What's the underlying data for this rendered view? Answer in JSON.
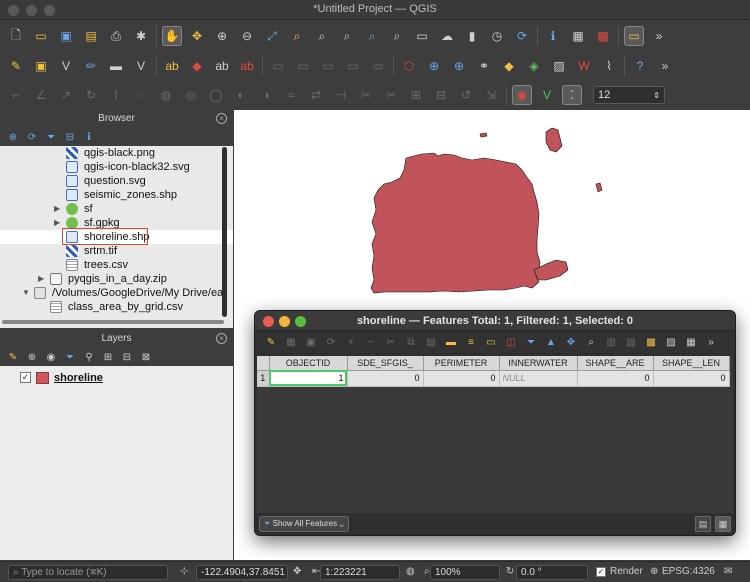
{
  "window": {
    "title": "*Untitled Project — QGIS"
  },
  "toolbar": {
    "row1_icons": [
      "new-project",
      "open",
      "save",
      "save-as",
      "print-layout",
      "style-manager",
      "pan",
      "pan-to-selection",
      "zoom-in",
      "zoom-out",
      "zoom-full",
      "zoom-to-selection",
      "zoom-to-layer",
      "zoom-native",
      "zoom-last",
      "zoom-next",
      "new-map-view",
      "new-3d-view",
      "refresh",
      "identify",
      "open-attribute-table",
      "field-calculator",
      "select-features",
      "deselect",
      "measure",
      "time-controller",
      "map-tips"
    ],
    "row2_icons": [
      "digitize",
      "layer-style",
      "label-toolbar",
      "edit-pencil",
      "save-edits",
      "add-feature",
      "label-abc",
      "pin-labels",
      "show-hide-labels",
      "label-highlight",
      "move-label",
      "rotate-label",
      "change-label",
      "diagram",
      "polygon-tool",
      "processing-toolbox",
      "plugin",
      "python-console",
      "qgis-help"
    ],
    "font_size": "12"
  },
  "browser": {
    "title": "Browser",
    "items": [
      {
        "label": "qgis-black.png",
        "icon": "raster-icon",
        "level": 3
      },
      {
        "label": "qgis-icon-black32.svg",
        "icon": "svg-icon",
        "level": 3
      },
      {
        "label": "question.svg",
        "icon": "svg-icon",
        "level": 3
      },
      {
        "label": "seismic_zones.shp",
        "icon": "vector-polygon-icon",
        "level": 3
      },
      {
        "label": "sf",
        "icon": "geopackage-icon",
        "level": 3,
        "expandable": true
      },
      {
        "label": "sf.gpkg",
        "icon": "geopackage-icon",
        "level": 3,
        "expandable": true
      },
      {
        "label": "shoreline.shp",
        "icon": "vector-polygon-icon",
        "level": 3,
        "selected": true
      },
      {
        "label": "srtm.tif",
        "icon": "raster-icon",
        "level": 3
      },
      {
        "label": "trees.csv",
        "icon": "table-icon",
        "level": 3
      },
      {
        "label": "pyqgis_in_a_day.zip",
        "icon": "zip-icon",
        "level": 2,
        "expandable": true
      },
      {
        "label": "/Volumes/GoogleDrive/My Drive/ear",
        "icon": "folder-icon",
        "level": 1,
        "expanded": true
      },
      {
        "label": "class_area_by_grid.csv",
        "icon": "table-icon",
        "level": 2
      }
    ]
  },
  "layers": {
    "title": "Layers",
    "items": [
      {
        "name": "shoreline",
        "checked": true,
        "swatch": "#d2575c"
      }
    ]
  },
  "map": {
    "fill": "#c0545a",
    "stroke": "#111111"
  },
  "attribute_table": {
    "title": "shoreline — Features Total: 1, Filtered: 1, Selected: 0",
    "columns": [
      "OBJECTID",
      "SDE_SFGIS_",
      "PERIMETER",
      "INNERWATER",
      "SHAPE__ARE",
      "SHAPE__LEN"
    ],
    "rows": [
      {
        "num": "1",
        "cells": [
          "1",
          "0",
          "0",
          "NULL",
          "0",
          "0"
        ]
      }
    ],
    "filter_button": "Show All Features"
  },
  "statusbar": {
    "locate_placeholder": "Type to locate (⌘K)",
    "coordinate": "-122.4904,37.8451",
    "scale": "1:223221",
    "magnifier": "100%",
    "rotation": "0.0 °",
    "render_label": "Render",
    "render_checked": true,
    "crs": "EPSG:4326"
  }
}
